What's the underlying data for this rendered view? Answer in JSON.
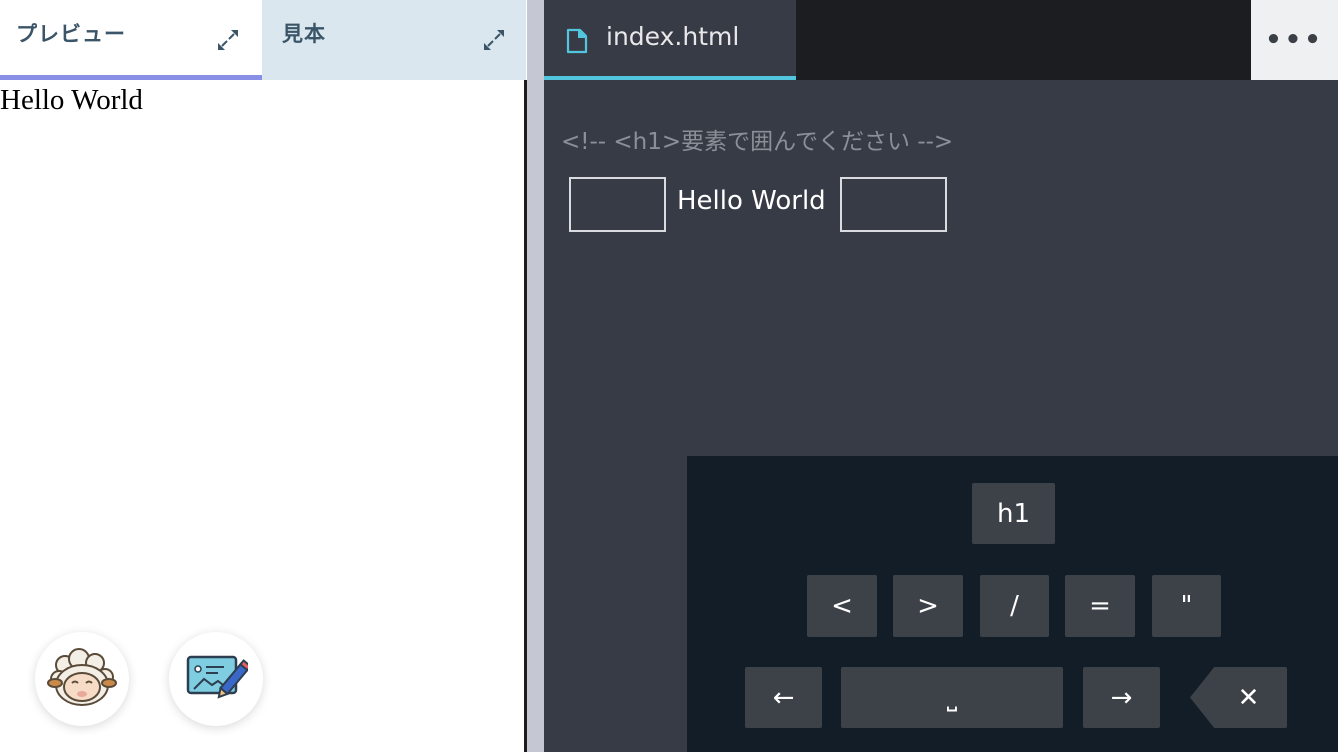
{
  "preview_panel": {
    "tabs": [
      {
        "label": "プレビュー"
      },
      {
        "label": "見本"
      }
    ],
    "preview_output": "Hello World"
  },
  "editor": {
    "file_tab": {
      "name": "index.html"
    },
    "more_label": "•••",
    "code": {
      "comment": "<!-- <h1>要素で囲んでください -->",
      "content": "Hello World"
    }
  },
  "keypad": {
    "tag_key": "h1",
    "symbol_keys": [
      "<",
      ">",
      "/",
      "=",
      "\""
    ],
    "nav_keys": {
      "left": "←",
      "space": "⎵",
      "right": "→",
      "delete": "✕"
    }
  },
  "colors": {
    "active_tab_underline": "#8a8fe6",
    "sample_tab_bg": "#dbe7ee",
    "editor_bg": "#373b45",
    "file_tab_accent": "#53c6df",
    "keypad_bg": "#121d27"
  }
}
